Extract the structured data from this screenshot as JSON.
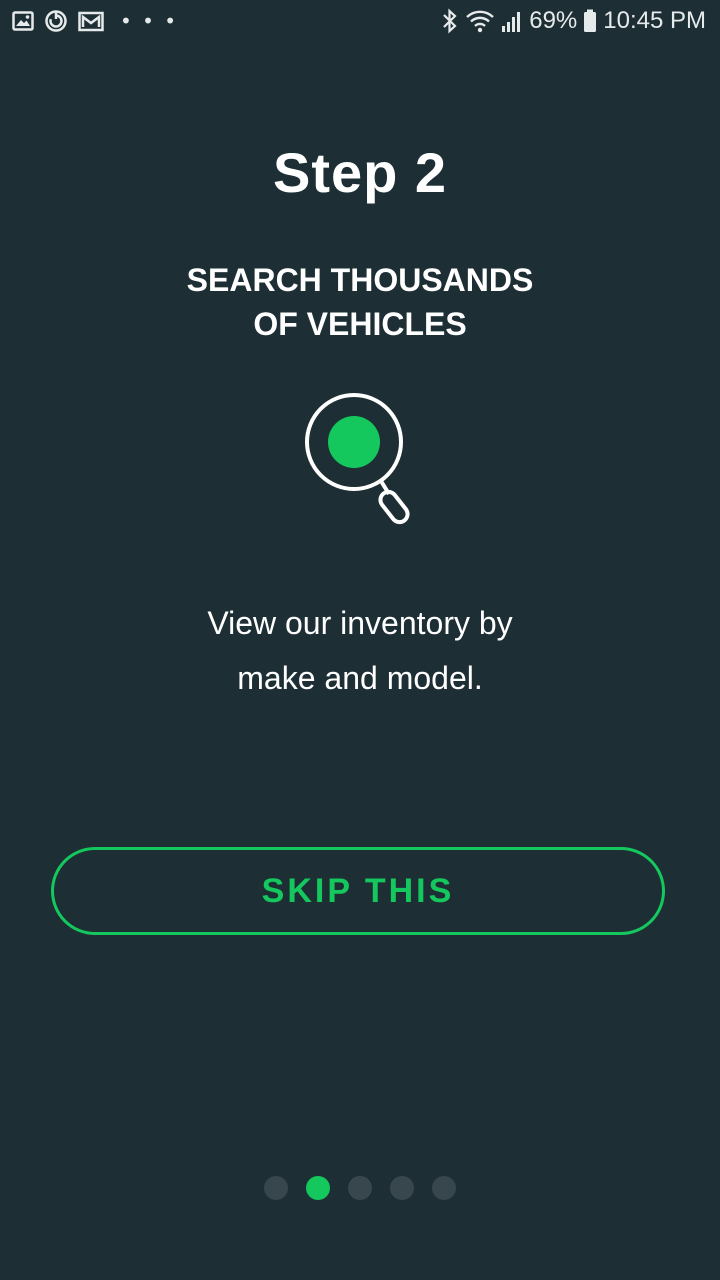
{
  "status_bar": {
    "left_icons": [
      "gallery-icon",
      "sync-icon",
      "gmail-icon"
    ],
    "more": "• • •",
    "battery_percent": "69%",
    "time": "10:45 PM",
    "right_icons": [
      "bluetooth-icon",
      "wifi-icon",
      "signal-icon",
      "battery-icon"
    ]
  },
  "onboarding": {
    "step_title": "Step 2",
    "subtitle_line1": "SEARCH THOUSANDS",
    "subtitle_line2": "OF VEHICLES",
    "illustration_icon": "magnifier-search-icon",
    "description_line1": "View our inventory by",
    "description_line2": "make and model.",
    "skip_label": "SKIP THIS",
    "page_count": 5,
    "current_page": 2
  },
  "colors": {
    "background": "#1d2f35",
    "accent": "#14c85d",
    "inactive_dot": "#37474d",
    "text": "#ffffff"
  }
}
